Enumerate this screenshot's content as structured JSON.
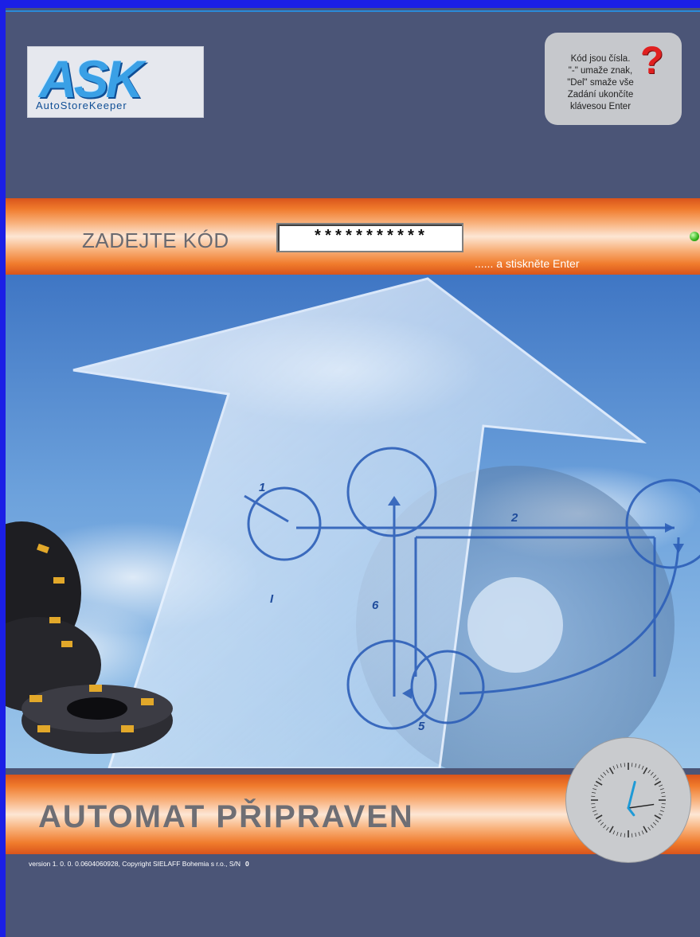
{
  "logo": {
    "mark": "ASK",
    "subtitle": "AutoStoreKeeper"
  },
  "help": {
    "lines": [
      "Kód jsou čísla.",
      "\"-\" umaže znak,",
      "\"Del\" smaže vše",
      "Zadání ukončíte",
      "klávesou Enter"
    ],
    "icon": "question-mark-icon"
  },
  "code_entry": {
    "label": "ZADEJTE KÓD",
    "value": "***********",
    "hint": "...... a stiskněte Enter"
  },
  "status": {
    "text": "AUTOMAT PŘIPRAVEN",
    "indicator_color": "#33b31a"
  },
  "footer": {
    "version": "version 1. 0. 0. 0.0604060928, Copyright SIELAFF Bohemia s r.o., S/N",
    "serial": "0"
  },
  "hero": {
    "diagram_labels": [
      "1",
      "2",
      "5",
      "6",
      "I"
    ]
  },
  "clock": {
    "hour_hand_angle_deg": 20,
    "minute_hand_angle_deg": 100
  },
  "colors": {
    "background": "#4b5577",
    "band_orange": "#f07b2c",
    "frame_blue": "#1b1fe6"
  }
}
